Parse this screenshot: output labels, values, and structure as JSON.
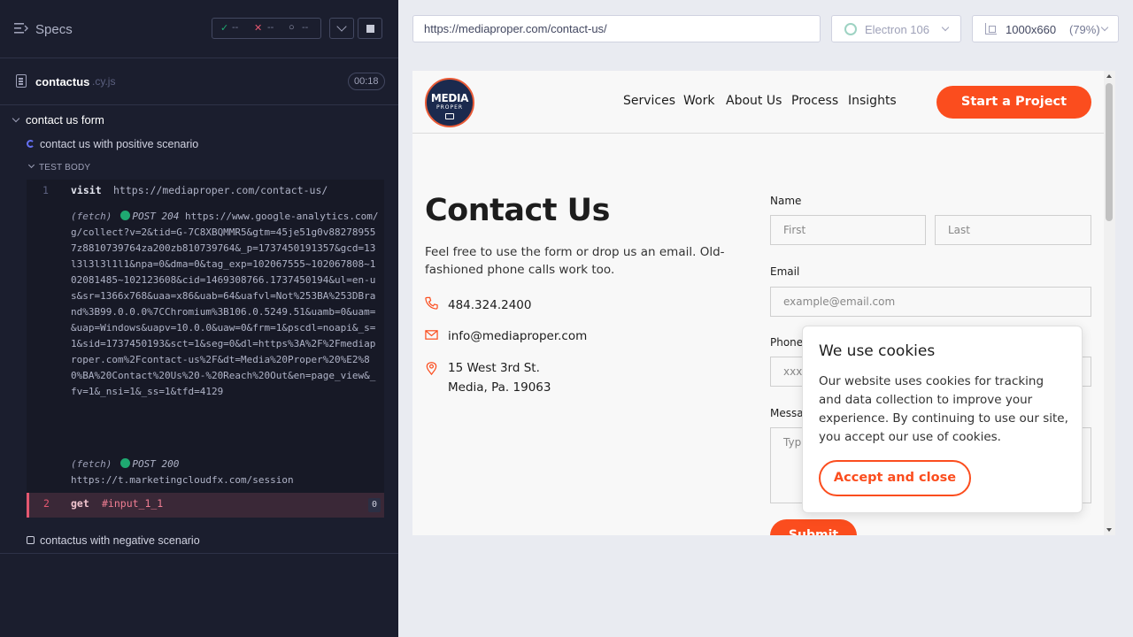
{
  "runner": {
    "specs_label": "Specs",
    "stats": {
      "passed": "--",
      "failed": "--",
      "pending": "--"
    },
    "spec_file": {
      "name": "contactus",
      "ext": ".cy.js",
      "duration": "00:18"
    },
    "suite_title": "contact us form",
    "test_running": "contact us with positive scenario",
    "test_body_label": "TEST BODY",
    "commands": [
      {
        "num": "1",
        "name": "visit",
        "message": "https://mediaproper.com/contact-us/"
      },
      {
        "num": "2",
        "name": "get",
        "message": "#input_1_1",
        "count": "0"
      }
    ],
    "logs": [
      {
        "tag": "(fetch)",
        "status": "POST 204",
        "url": "https://www.google-analytics.com/g/collect?v=2&tid=G-7C8XBQMMR5&gtm=45je51g0v882789557z8810739764za200zb810739764&_p=1737450191357&gcd=13l3l3l3l1l1&npa=0&dma=0&tag_exp=102067555~102067808~102081485~102123608&cid=1469308766.1737450194&ul=en-us&sr=1366x768&uaa=x86&uab=64&uafvl=Not%253BA%253DBrand%3B99.0.0.0%7CChromium%3B106.0.5249.51&uamb=0&uam=&uap=Windows&uapv=10.0.0&uaw=0&frm=1&pscdl=noapi&_s=1&sid=1737450193&sct=1&seg=0&dl=https%3A%2F%2Fmediaproper.com%2Fcontact-us%2F&dt=Media%20Proper%20%E2%80%BA%20Contact%20Us%20-%20Reach%20Out&en=page_view&_fv=1&_nsi=1&_ss=1&tfd=4129"
      },
      {
        "tag": "(fetch)",
        "status": "POST 200",
        "url": "https://t.marketingcloudfx.com/session"
      }
    ],
    "test_pending": "contactus with negative scenario"
  },
  "browser": {
    "url": "https://mediaproper.com/contact-us/",
    "name": "Electron 106",
    "viewport": "1000x660",
    "zoom": "(79%)"
  },
  "site": {
    "logo_top": "MEDIA",
    "logo_bottom": "PROPER",
    "nav": [
      "Services",
      "Work",
      "About Us",
      "Process",
      "Insights"
    ],
    "cta": "Start a Project",
    "heading": "Contact Us",
    "lead": "Feel free to use the form or drop us an email. Old-fashioned phone calls work too.",
    "phone": "484.324.2400",
    "email": "info@mediaproper.com",
    "address_line1": "15 West 3rd St.",
    "address_line2": "Media, Pa. 19063",
    "form": {
      "name_label": "Name",
      "first_placeholder": "First",
      "last_placeholder": "Last",
      "email_label": "Email",
      "email_placeholder": "example@email.com",
      "phone_label": "Phone",
      "phone_placeholder": "xxx-",
      "message_label": "Messa",
      "message_placeholder": "Typ",
      "submit": "Submit"
    },
    "cookie": {
      "title": "We use cookies",
      "text": "Our website uses cookies for tracking and data collection to improve your experience. By continuing to use our site, you accept our use of cookies.",
      "button": "Accept and close"
    }
  },
  "colors": {
    "accent": "#fb4d1e",
    "runner_bg": "#1b1e2e",
    "pass": "#1fa971",
    "fail": "#e45770"
  }
}
